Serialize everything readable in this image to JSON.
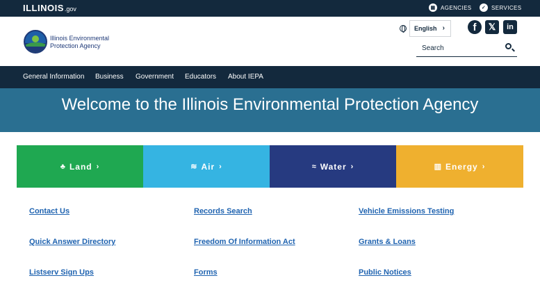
{
  "topbar": {
    "state_name": "ILLINOIS",
    "state_suffix": ".gov",
    "agencies_label": "AGENCIES",
    "services_label": "SERVICES"
  },
  "header": {
    "agency_name_line1": "Illinois Environmental",
    "agency_name_line2": "Protection Agency",
    "language": "English",
    "search_placeholder": "Search",
    "social": [
      "facebook-icon",
      "x-icon",
      "linkedin-icon"
    ]
  },
  "nav": {
    "items": [
      "General Information",
      "Business",
      "Government",
      "Educators",
      "About IEPA"
    ]
  },
  "hero": {
    "title": "Welcome to the Illinois Environmental Protection Agency"
  },
  "tiles": [
    {
      "label": "Land",
      "icon": "tree-icon",
      "color": "#1fa851"
    },
    {
      "label": "Air",
      "icon": "wind-icon",
      "color": "#35b4e2"
    },
    {
      "label": "Water",
      "icon": "waves-icon",
      "color": "#263a80"
    },
    {
      "label": "Energy",
      "icon": "building-icon",
      "color": "#efb02f"
    }
  ],
  "quick_links": [
    [
      "Contact Us",
      "Records Search",
      "Vehicle Emissions Testing"
    ],
    [
      "Quick Answer Directory",
      "Freedom Of Information Act",
      "Grants & Loans"
    ],
    [
      "Listserv Sign Ups",
      "Forms",
      "Public Notices"
    ]
  ],
  "colors": {
    "dark_navy": "#13293d",
    "hero_teal": "#2a6f91",
    "link_blue": "#1f63b0"
  }
}
